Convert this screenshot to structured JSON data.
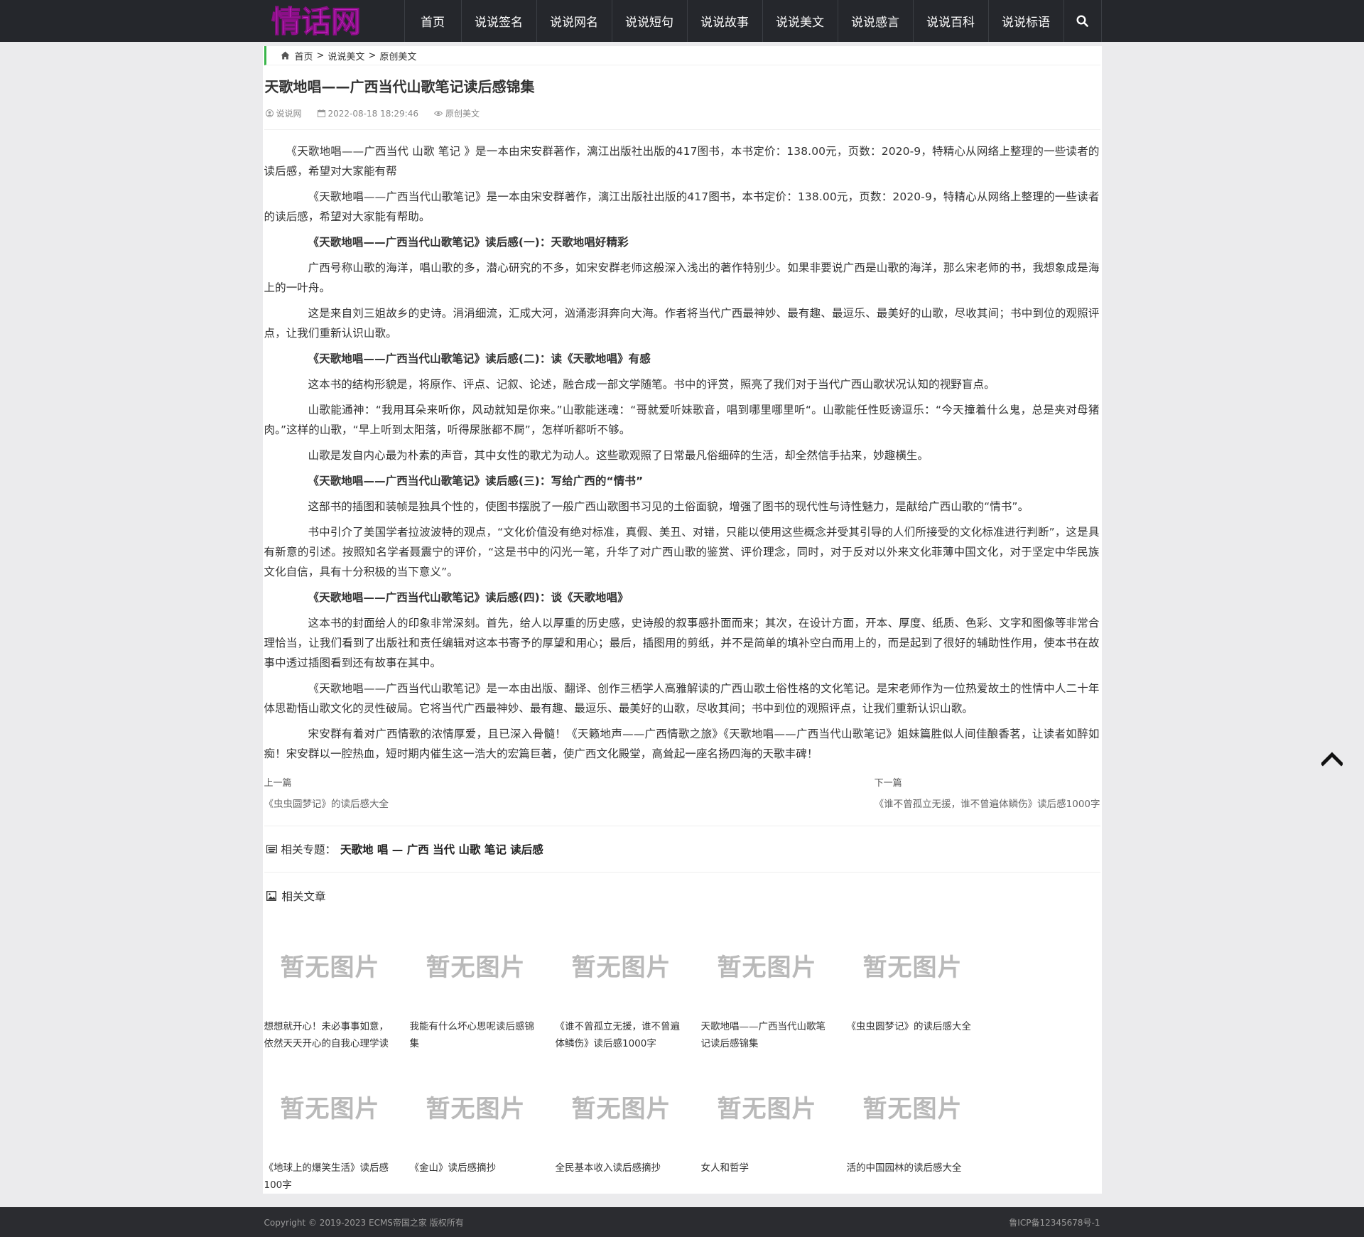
{
  "header": {
    "logo_text": "情话网",
    "nav": [
      {
        "label": "首页"
      },
      {
        "label": "说说签名"
      },
      {
        "label": "说说网名"
      },
      {
        "label": "说说短句"
      },
      {
        "label": "说说故事"
      },
      {
        "label": "说说美文"
      },
      {
        "label": "说说感言"
      },
      {
        "label": "说说百科"
      },
      {
        "label": "说说标语"
      }
    ]
  },
  "breadcrumb": {
    "items": [
      "首页",
      "说说美文",
      "原创美文"
    ],
    "separator": ">"
  },
  "article": {
    "title": "天歌地唱——广西当代山歌笔记读后感锦集",
    "author": "说说网",
    "date": "2022-08-18 18:29:46",
    "category": "原创美文",
    "paragraphs": [
      {
        "style": "normal",
        "text": "《天歌地唱——广西当代 山歌 笔记 》是一本由宋安群著作，漓江出版社出版的417图书，本书定价：138.00元，页数：2020-9，特精心从网络上整理的一些读者的读后感，希望对大家能有帮"
      },
      {
        "style": "indent4",
        "text": "《天歌地唱——广西当代山歌笔记》是一本由宋安群著作，漓江出版社出版的417图书，本书定价：138.00元，页数：2020-9，特精心从网络上整理的一些读者的读后感，希望对大家能有帮助。"
      },
      {
        "style": "heading",
        "text": "《天歌地唱——广西当代山歌笔记》读后感(一)：天歌地唱好精彩"
      },
      {
        "style": "indent4",
        "text": "广西号称山歌的海洋，唱山歌的多，潜心研究的不多，如宋安群老师这般深入浅出的著作特别少。如果非要说广西是山歌的海洋，那么宋老师的书，我想象成是海上的一叶舟。"
      },
      {
        "style": "indent4",
        "text": "这是来自刘三姐故乡的史诗。涓涓细流，汇成大河，汹涌澎湃奔向大海。作者将当代广西最神妙、最有趣、最逗乐、最美好的山歌，尽收其间；书中到位的观照评点，让我们重新认识山歌。"
      },
      {
        "style": "heading",
        "text": "《天歌地唱——广西当代山歌笔记》读后感(二)：读《天歌地唱》有感"
      },
      {
        "style": "indent4",
        "text": "这本书的结构形貌是，将原作、评点、记叙、论述，融合成一部文学随笔。书中的评赏，照亮了我们对于当代广西山歌状况认知的视野盲点。"
      },
      {
        "style": "indent4",
        "text": "山歌能通神：“我用耳朵来听你，风动就知是你来。”山歌能迷魂：“哥就爱听妹歌音，唱到哪里哪里听“。山歌能任性贬谤逗乐：“今天撞着什么鬼，总是夹对母猪肉。”这样的山歌，“早上听到太阳落，听得尿胀都不屙”，怎样听都听不够。"
      },
      {
        "style": "indent4",
        "text": "山歌是发自内心最为朴素的声音，其中女性的歌尤为动人。这些歌观照了日常最凡俗细碎的生活，却全然信手拈来，妙趣横生。"
      },
      {
        "style": "heading",
        "text": "《天歌地唱——广西当代山歌笔记》读后感(三)：写给广西的“情书”"
      },
      {
        "style": "indent4",
        "text": "这部书的插图和装帧是独具个性的，使图书摆脱了一般广西山歌图书习见的土俗面貌，增强了图书的现代性与诗性魅力，是献给广西山歌的“情书”。"
      },
      {
        "style": "indent4",
        "text": "书中引介了美国学者拉波波特的观点，“文化价值没有绝对标准，真假、美丑、对错，只能以使用这些概念并受其引导的人们所接受的文化标准进行判断”，这是具有新意的引述。按照知名学者聂震宁的评价，“这是书中的闪光一笔，升华了对广西山歌的鉴赏、评价理念，同时，对于反对以外来文化菲薄中国文化，对于坚定中华民族文化自信，具有十分积极的当下意义”。"
      },
      {
        "style": "heading",
        "text": "《天歌地唱——广西当代山歌笔记》读后感(四)：谈《天歌地唱》"
      },
      {
        "style": "indent4",
        "text": "这本书的封面给人的印象非常深刻。首先，给人以厚重的历史感，史诗般的叙事感扑面而来；其次，在设计方面，开本、厚度、纸质、色彩、文字和图像等非常合理恰当，让我们看到了出版社和责任编辑对这本书寄予的厚望和用心；最后，插图用的剪纸，并不是简单的填补空白而用上的，而是起到了很好的辅助性作用，使本书在故事中透过插图看到还有故事在其中。"
      },
      {
        "style": "indent4",
        "text": "《天歌地唱——广西当代山歌笔记》是一本由出版、翻译、创作三栖学人高雅解读的广西山歌土俗性格的文化笔记。是宋老师作为一位热爱故土的性情中人二十年体思勘悟山歌文化的灵性破局。它将当代广西最神妙、最有趣、最逗乐、最美好的山歌，尽收其间；书中到位的观照评点，让我们重新认识山歌。"
      },
      {
        "style": "indent4",
        "text": "宋安群有着对广西情歌的浓情厚爱，且已深入骨髓！《天籁地声——广西情歌之旅》《天歌地唱——广西当代山歌笔记》姐妹篇胜似人间佳酿香茗，让读者如醉如痴！宋安群以一腔热血，短时期内催生这一浩大的宏篇巨著，使广西文化殿堂，高耸起一座名扬四海的天歌丰碑！"
      }
    ]
  },
  "prevnext": {
    "prev_label": "上一篇",
    "prev_title": "《虫虫圆梦记》的读后感大全",
    "next_label": "下一篇",
    "next_title": "《谁不曾孤立无援，谁不曾遍体鳞伤》读后感1000字"
  },
  "topic": {
    "label": "相关专题：",
    "value": "天歌地 唱 — 广西 当代 山歌 笔记 读后感"
  },
  "related": {
    "title": "相关文章",
    "placeholder_text": "暂无图片",
    "items": [
      {
        "title": "想想就开心！未必事事如意，依然天天开心的自我心理学读"
      },
      {
        "title": "我能有什么坏心思呢读后感锦集"
      },
      {
        "title": "《谁不曾孤立无援，谁不曾遍体鳞伤》读后感1000字"
      },
      {
        "title": "天歌地唱——广西当代山歌笔记读后感锦集"
      },
      {
        "title": "《虫虫圆梦记》的读后感大全"
      },
      {
        "title": "《地球上的爆笑生活》读后感100字"
      },
      {
        "title": "《金山》读后感摘抄"
      },
      {
        "title": "全民基本收入读后感摘抄"
      },
      {
        "title": "女人和哲学"
      },
      {
        "title": "活的中国园林的读后感大全"
      }
    ]
  },
  "footer": {
    "copyright": "Copyright © 2019-2023 ECMS帝国之家 版权所有",
    "icp": "鲁ICP备12345678号-1"
  },
  "colors": {
    "header_bg": "#25272c",
    "logo": "#d92bd5",
    "breadcrumb_accent": "#39b54a",
    "footer_bg": "#2b2c30"
  }
}
